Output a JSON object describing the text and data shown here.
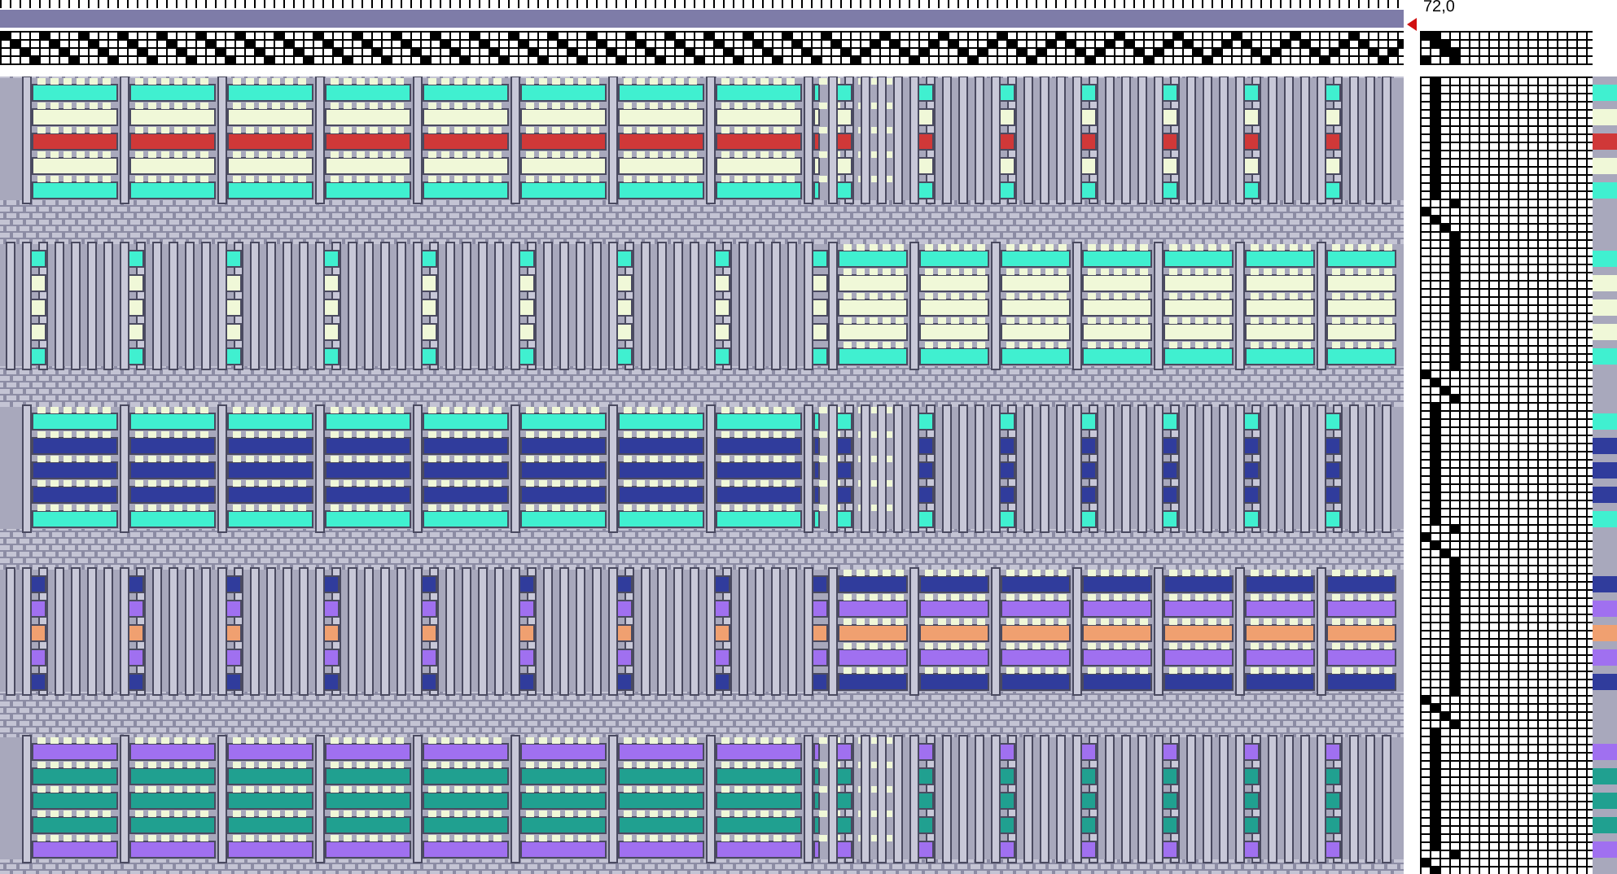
{
  "position_readout": "72,0"
}
